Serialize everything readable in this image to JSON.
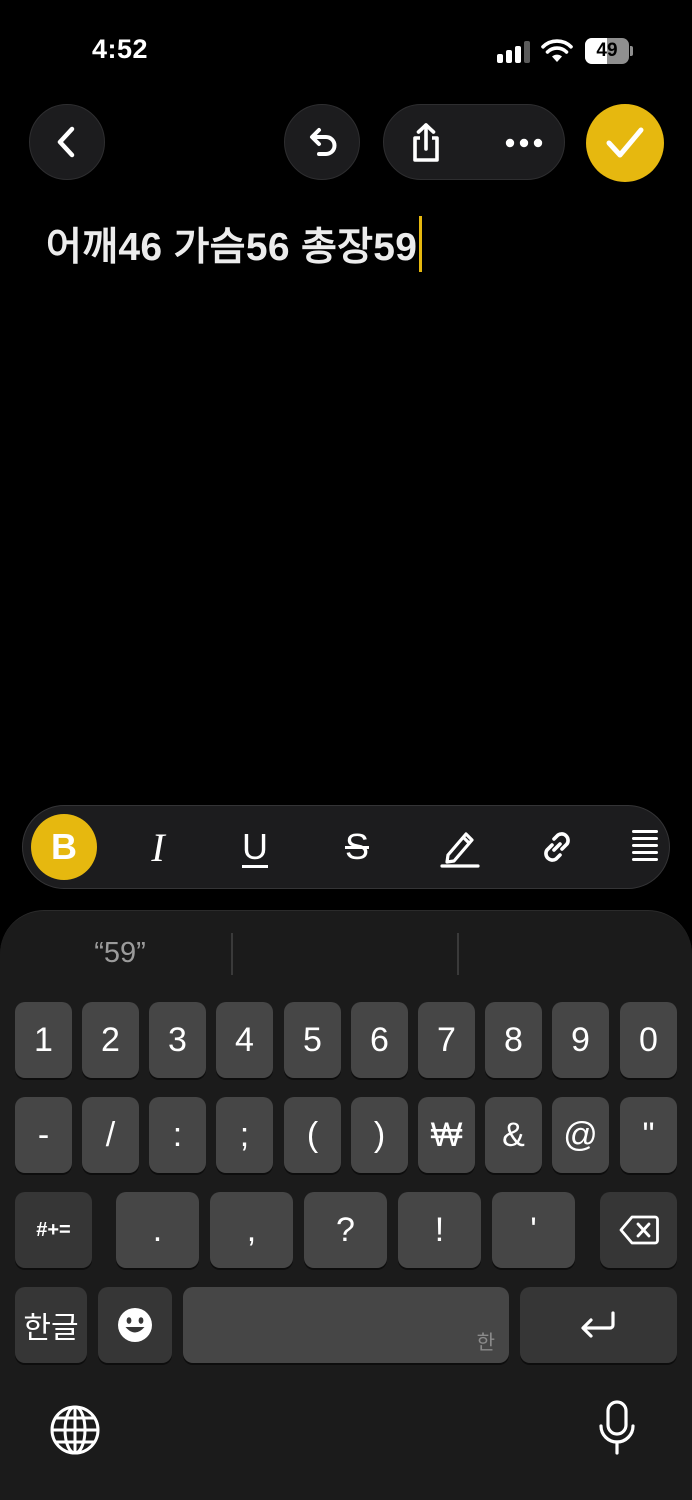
{
  "status_bar": {
    "time": "4:52",
    "battery_level": "49",
    "battery_fraction": 0.49,
    "signal_bars_active": 3,
    "signal_bars_total": 4
  },
  "nav": {
    "back_icon": "chevron-left-icon",
    "undo_icon": "undo-icon",
    "share_icon": "share-icon",
    "more_icon": "ellipsis-icon",
    "done_icon": "checkmark-icon"
  },
  "note": {
    "text": "어깨46 가슴56 총장59"
  },
  "format_toolbar": {
    "bold": "B",
    "italic": "I",
    "underline": "U",
    "strikethrough": "S",
    "highlight_icon": "pen-icon",
    "link_icon": "link-icon",
    "align_icon": "text-align-icon"
  },
  "keyboard": {
    "suggestions": [
      "“59”",
      "",
      ""
    ],
    "row1": [
      "1",
      "2",
      "3",
      "4",
      "5",
      "6",
      "7",
      "8",
      "9",
      "0"
    ],
    "row2": [
      "-",
      "/",
      ":",
      ";",
      "(",
      ")",
      "₩",
      "&",
      "@",
      "\""
    ],
    "row3": {
      "symbols_toggle": "#+=",
      "keys": [
        ".",
        ",",
        "?",
        "!",
        "'"
      ],
      "delete_icon": "backspace-icon"
    },
    "row4": {
      "language": "한글",
      "emoji_icon": "emoji-icon",
      "space_sub": "한",
      "return_icon": "return-icon"
    },
    "globe_icon": "globe-icon",
    "mic_icon": "microphone-icon"
  },
  "colors": {
    "accent": "#e6b80f",
    "background": "#000000",
    "keyboard_bg": "#1b1b1b",
    "key_bg": "#464646"
  }
}
